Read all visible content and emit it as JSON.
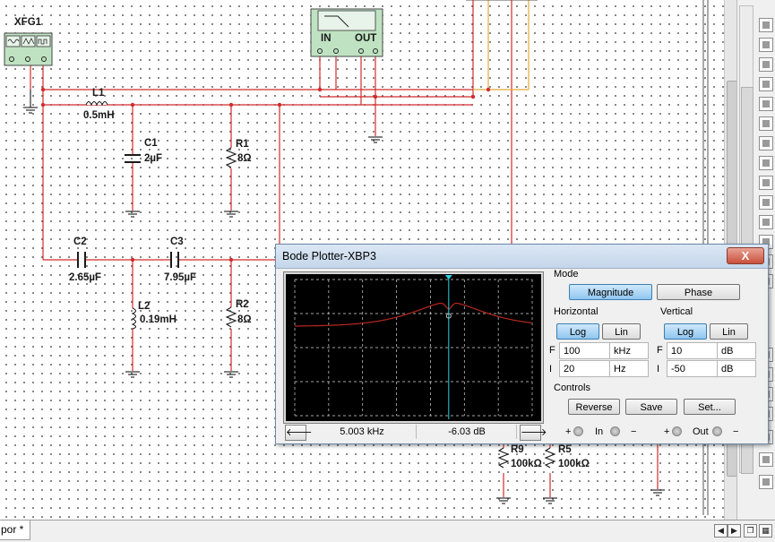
{
  "schematic": {
    "instruments": {
      "function_gen": "XFG1",
      "bode_in": "IN",
      "bode_out": "OUT"
    },
    "components": [
      {
        "ref": "L1",
        "value": "0.5mH"
      },
      {
        "ref": "C1",
        "value": "2µF"
      },
      {
        "ref": "R1",
        "value": "8Ω"
      },
      {
        "ref": "C2",
        "value": "2.65µF"
      },
      {
        "ref": "C3",
        "value": "7.95µF"
      },
      {
        "ref": "L2",
        "value": "0.19mH"
      },
      {
        "ref": "R2",
        "value": "8Ω"
      },
      {
        "ref": "R9",
        "value": "100kΩ"
      },
      {
        "ref": "R5",
        "value": "100kΩ"
      }
    ],
    "colors": {
      "wire": "#d12b2b",
      "wire_alt": "#e2a83a",
      "ground": "#1a1a1a"
    }
  },
  "bode": {
    "title": "Bode Plotter-XBP3",
    "close_label": "X",
    "mode_label": "Mode",
    "magnitude_label": "Magnitude",
    "phase_label": "Phase",
    "horizontal_label": "Horizontal",
    "vertical_label": "Vertical",
    "log_label": "Log",
    "lin_label": "Lin",
    "h_final": {
      "letter": "F",
      "value": "100",
      "unit": "kHz"
    },
    "h_initial": {
      "letter": "I",
      "value": "20",
      "unit": "Hz"
    },
    "v_final": {
      "letter": "F",
      "value": "10",
      "unit": "dB"
    },
    "v_initial": {
      "letter": "I",
      "value": "-50",
      "unit": "dB"
    },
    "controls_label": "Controls",
    "reverse_label": "Reverse",
    "save_label": "Save",
    "set_label": "Set...",
    "in_label": "In",
    "out_label": "Out",
    "plus": "+",
    "minus": "−",
    "cursor_freq": "5.003 kHz",
    "cursor_gain": "-6.03 dB",
    "colors": {
      "trace": "#b8281f",
      "cursor": "#2ad4e0",
      "plot_bg": "#000000"
    }
  },
  "statusbar": {
    "tab_label": "por *"
  }
}
